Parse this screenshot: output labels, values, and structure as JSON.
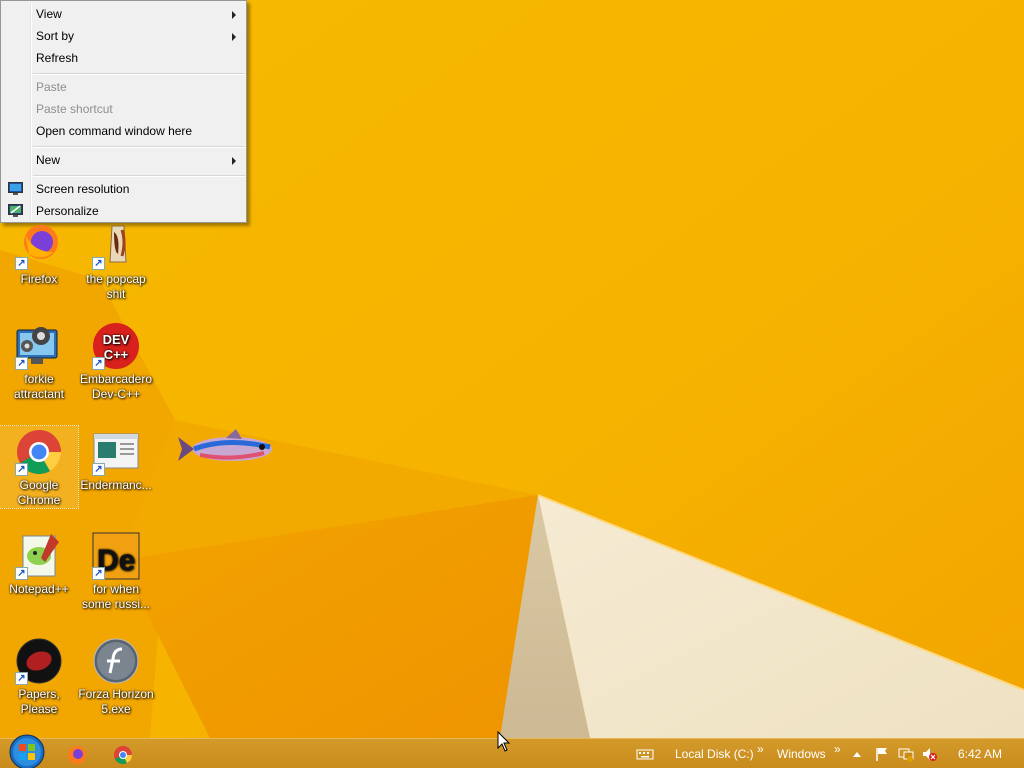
{
  "context_menu": {
    "items": [
      {
        "label": "View",
        "submenu": true
      },
      {
        "label": "Sort by",
        "submenu": true
      },
      {
        "label": "Refresh"
      },
      {
        "label": "Paste",
        "disabled": true
      },
      {
        "label": "Paste shortcut",
        "disabled": true
      },
      {
        "label": "Open command window here"
      },
      {
        "label": "New",
        "submenu": true
      },
      {
        "label": "Screen resolution",
        "icon": "display-icon"
      },
      {
        "label": "Personalize",
        "icon": "personalize-icon"
      }
    ]
  },
  "desktop_icons": [
    {
      "label": "Firefox",
      "icon": "firefox-icon"
    },
    {
      "label": "the popcap shit",
      "icon": "popcap-folder-icon"
    },
    {
      "label": "forkie attractant",
      "icon": "settings-monitor-icon"
    },
    {
      "label": "Embarcadero Dev-C++",
      "icon": "devcpp-icon"
    },
    {
      "label": "Google Chrome",
      "icon": "chrome-icon",
      "selected": true
    },
    {
      "label": "Endermanc...",
      "icon": "window-app-icon"
    },
    {
      "label": "Notepad++",
      "icon": "notepadpp-icon"
    },
    {
      "label": "for when some russi...",
      "icon": "de-app-icon"
    },
    {
      "label": "Papers, Please",
      "icon": "papers-please-icon"
    },
    {
      "label": "Forza Horizon 5.exe",
      "icon": "flash-icon"
    }
  ],
  "taskbar": {
    "apps": [
      "firefox-icon",
      "chrome-icon"
    ],
    "toolbars": [
      "Local Disk (C:)",
      "Windows"
    ],
    "chevron": "»",
    "clock": "6:42 AM"
  },
  "colors": {
    "wallpaper": "#f6b800",
    "taskbar": "#c88b1c",
    "menu_bg": "#f0f0f0"
  }
}
